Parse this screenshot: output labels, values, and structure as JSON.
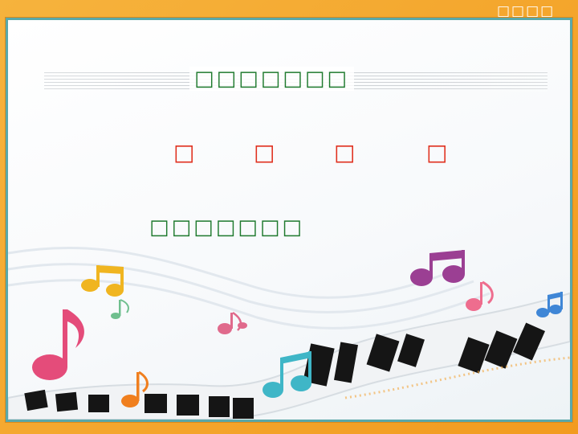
{
  "corner_mark": "□□□□",
  "title": "□□□□□□□",
  "glyph_row": [
    "□",
    "□",
    "□",
    "□"
  ],
  "subtitle": "□□□□□□□",
  "colors": {
    "frame_orange": "#f4a52a",
    "card_border_teal": "#5aa8a9",
    "title_green": "#1f7a2e",
    "glyph_red": "#e0301e"
  },
  "icons": [
    "music-note-yellow",
    "music-note-green",
    "music-note-pink",
    "music-note-orange",
    "music-note-teal",
    "music-note-purple",
    "music-note-magenta",
    "music-note-blue",
    "piano-keys-ribbon"
  ]
}
